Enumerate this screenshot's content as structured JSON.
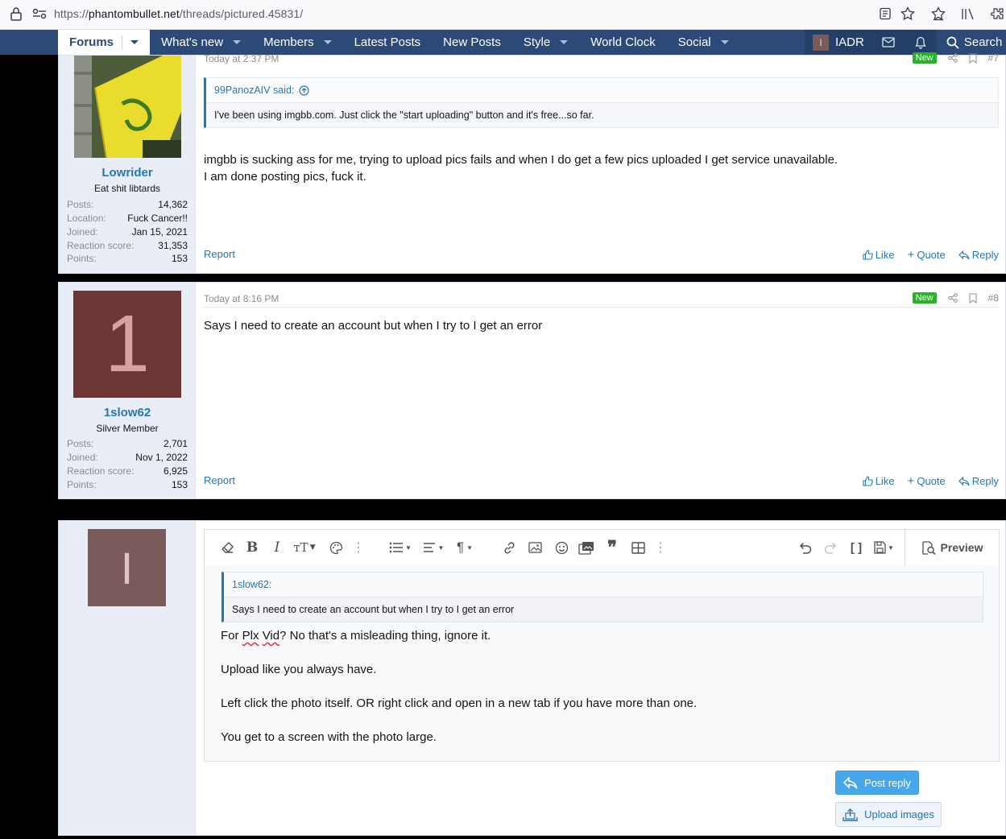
{
  "browser": {
    "url_scheme": "https://",
    "url_host": "phantombullet.net",
    "url_path": "/threads/pictured.45831/"
  },
  "nav": {
    "tabs": [
      {
        "label": "Forums",
        "caret": true,
        "active": true
      },
      {
        "label": "What's new",
        "caret": true
      },
      {
        "label": "Members",
        "caret": true
      },
      {
        "label": "Latest Posts",
        "caret": false
      },
      {
        "label": "New Posts",
        "caret": false
      },
      {
        "label": "Style",
        "caret": true
      },
      {
        "label": "World Clock",
        "caret": false
      },
      {
        "label": "Social",
        "caret": true
      }
    ],
    "user_initial": "I",
    "username": "IADR",
    "search_label": "Search"
  },
  "post7": {
    "author": "Lowrider",
    "title": "Eat shit libtards",
    "stats": [
      {
        "k": "Posts:",
        "v": "14,362"
      },
      {
        "k": "Location:",
        "v": "Fuck Cancer!!"
      },
      {
        "k": "Joined:",
        "v": "Jan 15, 2021"
      },
      {
        "k": "Reaction score:",
        "v": "31,353"
      },
      {
        "k": "Points:",
        "v": "153"
      }
    ],
    "timestamp": "Today at 2:37 PM",
    "badge": "New",
    "number": "#7",
    "quote_author": "99PanozAIV said:",
    "quote_text": "I've been using imgbb.com. Just click the \"start uploading\" button and it's free...so far.",
    "lines": [
      "imgbb is sucking ass for me, trying to upload pics fails and when I do get a few pics uploaded I get service unavailable.",
      "I am done posting pics, fuck it."
    ],
    "report": "Report",
    "like": "Like",
    "quote": "Quote",
    "reply": "Reply"
  },
  "post8": {
    "avatar_letter": "1",
    "avatar_color": "#6e3535",
    "author": "1slow62",
    "title": "Silver Member",
    "stats": [
      {
        "k": "Posts:",
        "v": "2,701"
      },
      {
        "k": "Joined:",
        "v": "Nov 1, 2022"
      },
      {
        "k": "Reaction score:",
        "v": "6,925"
      },
      {
        "k": "Points:",
        "v": "153"
      }
    ],
    "timestamp": "Today at 8:16 PM",
    "badge": "New",
    "number": "#8",
    "text": "Says I need to create an account but when I try to I get an error",
    "report": "Report",
    "like": "Like",
    "quote": "Quote",
    "reply": "Reply"
  },
  "reply": {
    "avatar_letter": "I",
    "avatar_color": "#7a5a5a",
    "preview_label": "Preview",
    "quote_author": "1slow62:",
    "quote_text": "Says I need to create an account but when I try to I get an error",
    "line1_pre": "For ",
    "line1_w1": "Plx",
    "line1_mid": " ",
    "line1_w2": "Vid",
    "line1_post": "?  No that's a misleading thing, ignore it.",
    "line2": "Upload like you always have.",
    "line3": "Left click the photo itself. OR right click and open in a new tab if you have more than one.",
    "line4": "You get to a screen with the photo large.",
    "post_reply": "Post reply",
    "upload_images": "Upload images"
  }
}
